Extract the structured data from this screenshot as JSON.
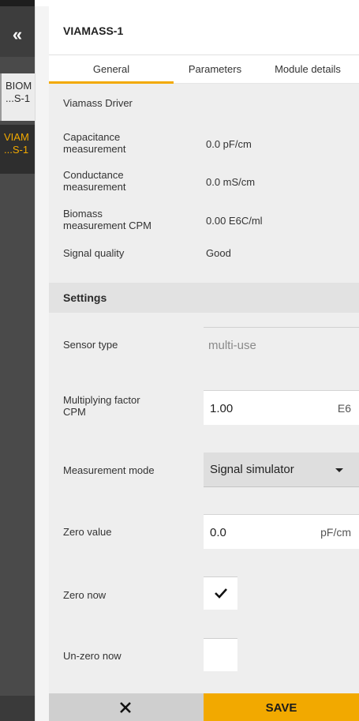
{
  "rail": {
    "collapse_icon": "double-chevron-left-icon",
    "items": [
      {
        "label_line1": "BIOM",
        "label_line2": "...S-1"
      },
      {
        "label_line1": "VIAM",
        "label_line2": "...S-1"
      }
    ]
  },
  "header": {
    "title": "VIAMASS-1"
  },
  "tabs": [
    {
      "label": "General"
    },
    {
      "label": "Parameters"
    },
    {
      "label": "Module details"
    }
  ],
  "general": {
    "driver": "Viamass Driver",
    "rows": [
      {
        "label_line1": "Capacitance",
        "label_line2": "measurement",
        "value": "0.0 pF/cm"
      },
      {
        "label_line1": "Conductance",
        "label_line2": "measurement",
        "value": "0.0 mS/cm"
      },
      {
        "label_line1": "Biomass",
        "label_line2": "measurement CPM",
        "value": "0.00 E6C/ml"
      },
      {
        "label_line1": "Signal quality",
        "label_line2": "",
        "value": "Good"
      }
    ]
  },
  "settings": {
    "title": "Settings",
    "sensor_type": {
      "label": "Sensor type",
      "value": "multi-use"
    },
    "multiplying_factor": {
      "label_line1": "Multiplying factor",
      "label_line2": "CPM",
      "value": "1.00",
      "unit": "E6"
    },
    "measurement_mode": {
      "label": "Measurement mode",
      "value": "Signal simulator"
    },
    "zero_value": {
      "label": "Zero value",
      "value": "0.0",
      "unit": "pF/cm"
    },
    "zero_now": {
      "label": "Zero now",
      "checked": true
    },
    "unzero_now": {
      "label": "Un-zero now",
      "checked": false
    }
  },
  "footer": {
    "cancel_icon": "close-icon",
    "save_label": "SAVE"
  },
  "colors": {
    "accent": "#f2a900",
    "rail": "#4a4a4a"
  }
}
